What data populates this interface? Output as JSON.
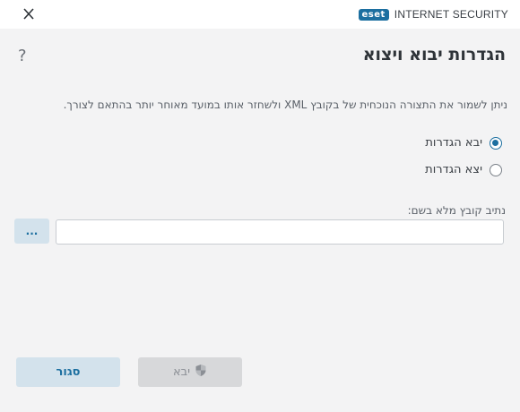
{
  "window": {
    "brand_logo": "eset",
    "brand_name": "INTERNET SECURITY",
    "close_icon": "close-icon",
    "help_label": "?"
  },
  "dialog": {
    "title": "הגדרות יבוא ויצוא",
    "description": "ניתן לשמור את התצורה הנוכחית של בקובץ XML ולשחזר אותו במועד מאוחר יותר בהתאם לצורך.",
    "options": [
      {
        "label": "יבא הגדרות",
        "selected": true
      },
      {
        "label": "יצא הגדרות",
        "selected": false
      }
    ],
    "file_label": "נתיב קובץ מלא בשם:",
    "file_value": "",
    "browse_label": "...",
    "close_label": "סגור",
    "import_label": "יבא",
    "import_icon": "shield-icon",
    "import_enabled": false
  },
  "colors": {
    "accent": "#1c6fa0",
    "background": "#f3f3f4",
    "secondary_button": "#d3e2ec",
    "disabled_button": "#d7d8da"
  }
}
